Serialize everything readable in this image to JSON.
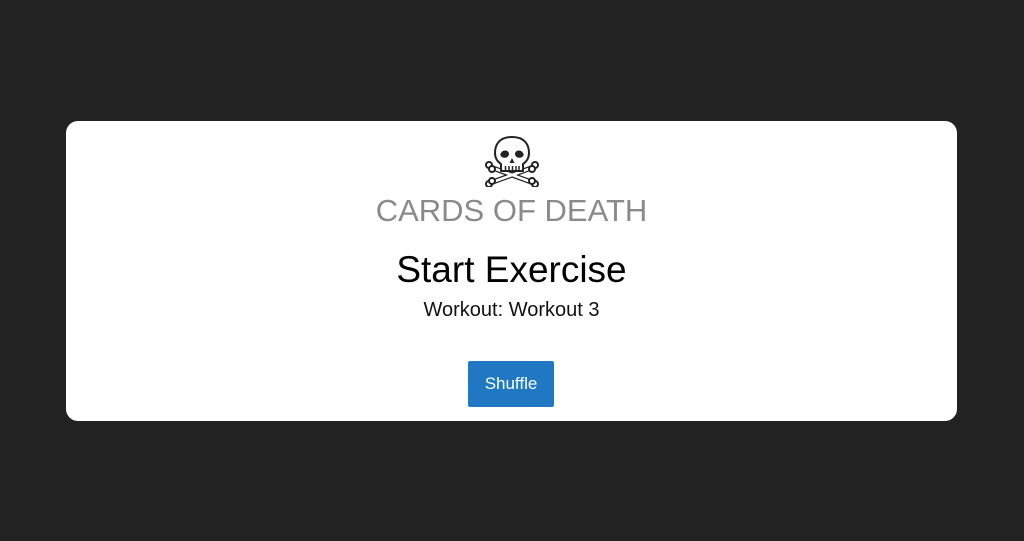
{
  "card": {
    "icon": "skull-and-crossbones-icon",
    "brand": "CARDS OF DEATH",
    "title": "Start Exercise",
    "subtitle": "Workout: Workout 3",
    "shuffle_label": "Shuffle"
  },
  "colors": {
    "background": "#222222",
    "card": "#ffffff",
    "brand_text": "#8a8a8a",
    "button": "#1f78c1",
    "button_text": "#ffffff"
  }
}
